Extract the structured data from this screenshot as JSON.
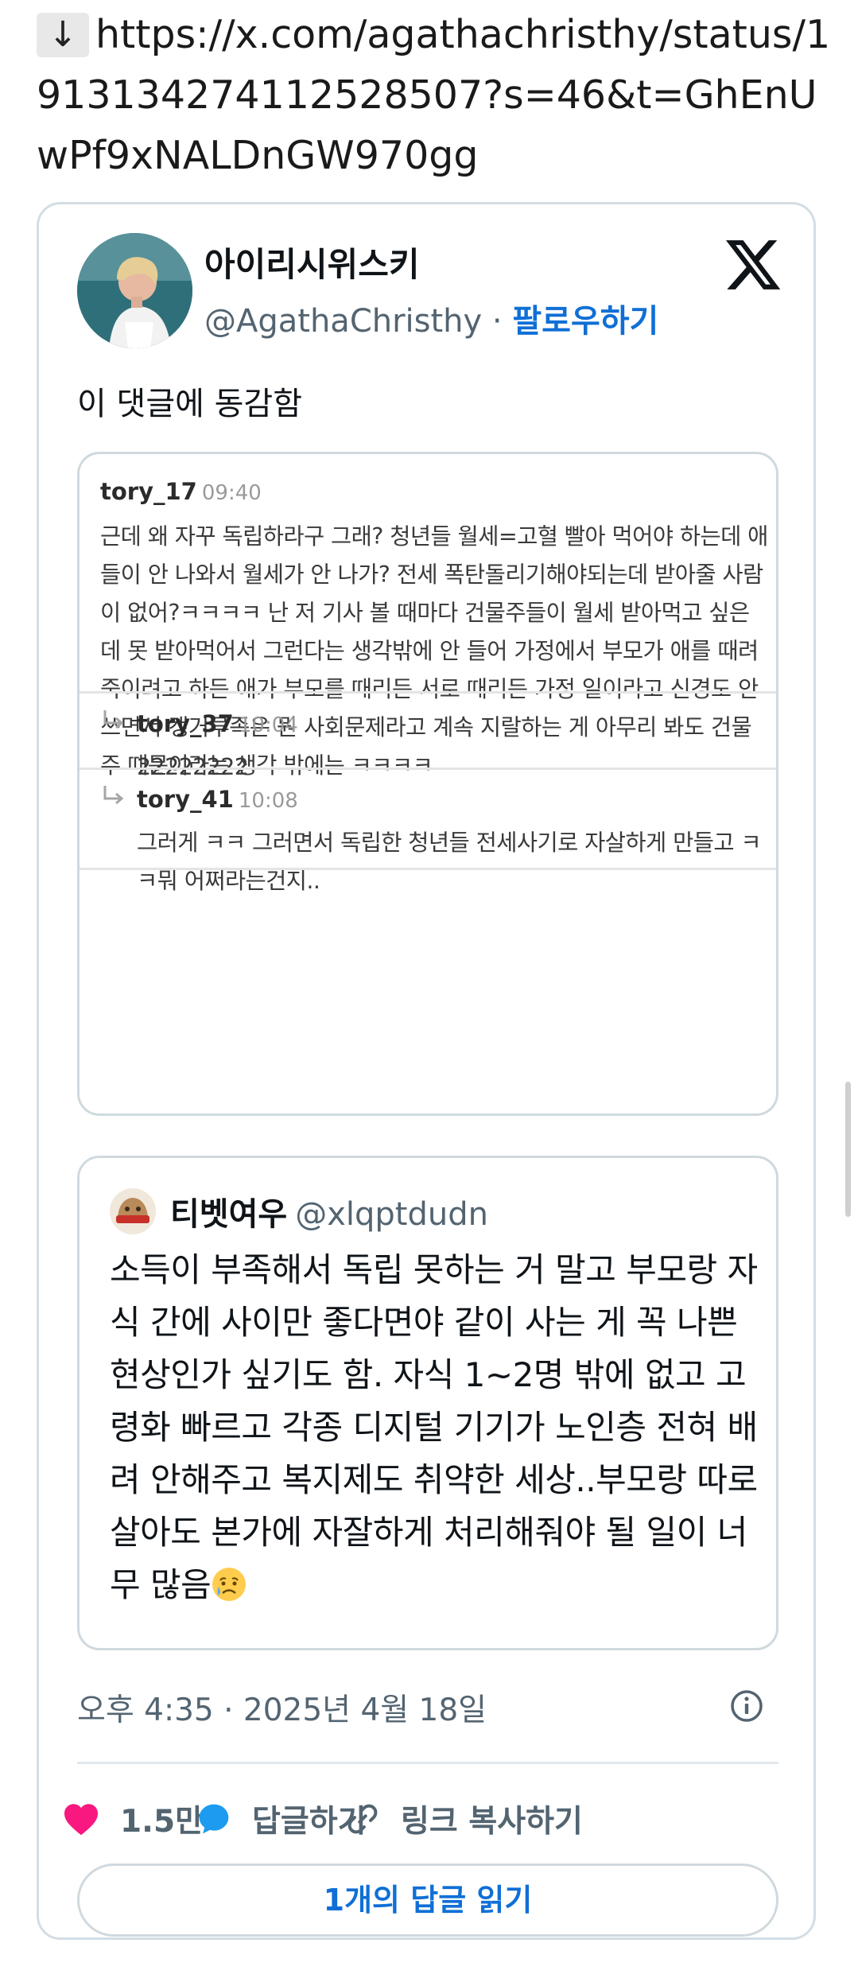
{
  "url": {
    "arrow": "↓",
    "text": "https://x.com/agathachristhy/status/1913134274112528507?s=46&t=GhEnUwPf9xNALDnGW970gg"
  },
  "tweet": {
    "display_name": "아이리시위스키",
    "handle": "@AgathaChristhy",
    "separator": " · ",
    "follow_label": "팔로우하기",
    "text": "이 댓글에 동감함",
    "timestamp": "오후 4:35 · 2025년 4월 18일",
    "likes": "1.5만",
    "reply_label": "답글하기",
    "copy_link_label": "링크 복사하기",
    "read_replies_label": "1개의 답글 읽기"
  },
  "comments": {
    "main": {
      "user": "tory_17",
      "time": "09:40",
      "text": "근데 왜 자꾸 독립하라구 그래? 청년들 월세=고혈 빨아 먹어야 하는데 애들이 안 나와서 월세가 안 나가? 전세 폭탄돌리기해야되는데 받아줄 사람이 없어?ㅋㅋㅋㅋ 난 저 기사 볼 때마다 건물주들이 월세 받아먹고 싶은데 못 받아먹어서 그런다는 생각밖에 안 들어 가정에서 부모가 애를 때려죽이려고 하든 애가 부모를 때리든 서로 때리든 가정 일이라고 신경도 안 쓰면서 캥거루족은 뭔 사회문제라고 계속 지랄하는 게 아무리 봐도 건물주 때문이라는 생각 밖에는 ㅋㅋㅋㅋ"
    },
    "replies": [
      {
        "user": "tory_37",
        "time": "10:04",
        "text": "22222222"
      },
      {
        "user": "tory_41",
        "time": "10:08",
        "text": "그러게 ㅋㅋ 그러면서 독립한 청년들 전세사기로 자살하게 만들고 ㅋㅋ뭐 어쩌라는건지.."
      }
    ]
  },
  "quote": {
    "name": "티벳여우",
    "handle": "@xlqptdudn",
    "text": "소득이 부족해서 독립 못하는 거 말고 부모랑 자식 간에 사이만 좋다면야 같이 사는 게 꼭 나쁜 현상인가 싶기도 함. 자식 1~2명 밖에 없고 고령화 빠르고 각종 디지털 기기가 노인층 전혀 배려 안해주고 복지제도 취약한 세상..부모랑 따로 살아도 본가에 자잘하게 처리해줘야 될 일이 너무 많음"
  },
  "colors": {
    "accent": "#0f6fd6",
    "heart": "#f91880",
    "reply_bubble": "#1d9bf0"
  },
  "icons": [
    "down-arrow-icon",
    "x-logo-icon",
    "reply-arrow-icon",
    "sad-emoji-icon",
    "info-icon",
    "heart-icon",
    "speech-bubble-icon",
    "link-icon"
  ]
}
